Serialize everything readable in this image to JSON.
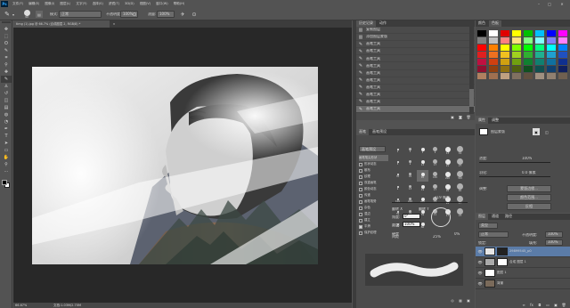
{
  "app": {
    "logo": "Ps"
  },
  "menubar": {
    "items": [
      "文件(F)",
      "编辑(E)",
      "图像(I)",
      "图层(L)",
      "文字(Y)",
      "选择(S)",
      "滤镜(T)",
      "3D(D)",
      "视图(V)",
      "窗口(W)",
      "帮助(H)"
    ]
  },
  "options": {
    "brush_size": "90",
    "mode_label": "模式:",
    "mode_value": "正常",
    "opacity_label": "不透明度:",
    "opacity_value": "100%",
    "flow_label": "流量:",
    "flow_value": "100%"
  },
  "document": {
    "tab_title": "timg (1).jpg @ 66.7% (合成图层 2, RGB/8) *"
  },
  "status": {
    "zoom": "66.67%",
    "doc_info": "文档:1.03M/2.70M"
  },
  "history": {
    "tabs": [
      "历史记录",
      "动作"
    ],
    "items": [
      "复制图层",
      "添加图层蒙版",
      "画笔工具",
      "画笔工具",
      "画笔工具",
      "画笔工具",
      "画笔工具",
      "画笔工具",
      "画笔工具",
      "画笔工具",
      "画笔工具",
      "画笔工具"
    ]
  },
  "swatches": {
    "tabs": [
      "颜色",
      "色板"
    ],
    "colors": [
      "#000000",
      "#ffffff",
      "#e00000",
      "#ffff00",
      "#00c000",
      "#00c0ff",
      "#0000ff",
      "#ff00ff",
      "#808080",
      "#c0c0c0",
      "#ff8080",
      "#ffe080",
      "#80ff80",
      "#80ffff",
      "#8080ff",
      "#ff80ff",
      "#ff0000",
      "#ff8000",
      "#ffff00",
      "#80ff00",
      "#00ff00",
      "#00ff80",
      "#00ffff",
      "#0080ff",
      "#e02020",
      "#f07020",
      "#f0c020",
      "#a0d020",
      "#30b030",
      "#20b090",
      "#20a0d0",
      "#2050c0",
      "#c01040",
      "#d04010",
      "#d0a010",
      "#70a010",
      "#108030",
      "#108070",
      "#1070a0",
      "#103090",
      "#901030",
      "#904010",
      "#907010",
      "#506010",
      "#105020",
      "#105050",
      "#104070",
      "#102060",
      "#b08060",
      "#a07050",
      "#c0a080",
      "#807060",
      "#605040",
      "#a09080",
      "#908070",
      "#706050"
    ]
  },
  "brush": {
    "tabs": [
      "画笔",
      "画笔预设"
    ],
    "preset_button": "画笔预设",
    "options": [
      "画笔笔尖形状",
      "形状动态",
      "散布",
      "纹理",
      "双重画笔",
      "颜色动态",
      "传递",
      "画笔笔势",
      "杂色",
      "湿边",
      "建立",
      "平滑",
      "保护纹理"
    ],
    "checked": [
      false,
      false,
      false,
      false,
      false,
      false,
      false,
      false,
      false,
      false,
      false,
      true,
      false
    ],
    "size_value": "119 像素",
    "flip_x": "翻转 X",
    "flip_y": "翻转 Y",
    "angle_label": "角度:",
    "angle_value": "0°",
    "roundness_label": "圆度:",
    "roundness_value": "100%",
    "hardness_label": "硬度",
    "hardness_value": "0%",
    "spacing_label": "间距",
    "spacing_value": "25%",
    "tip_sizes": [
      "1",
      "3",
      "5",
      "9",
      "13",
      "19",
      "5",
      "9",
      "13",
      "17",
      "21",
      "27",
      "35",
      "45",
      "65",
      "100",
      "200",
      "300",
      "9",
      "13",
      "19",
      "17",
      "45",
      "65",
      "100",
      "200",
      "300",
      "14",
      "24",
      "27",
      "39",
      "46",
      "59",
      "11",
      "17",
      "23",
      "36",
      "44",
      "60"
    ]
  },
  "properties": {
    "tabs": [
      "属性",
      "调整"
    ],
    "title": "图层蒙版",
    "density_label": "浓度:",
    "density_value": "100%",
    "feather_label": "羽化:",
    "feather_value": "0.0 像素",
    "refine_label": "调整:",
    "edge_button": "蒙版边缘...",
    "color_range_button": "颜色范围...",
    "invert_button": "反相"
  },
  "layers": {
    "tabs": [
      "图层",
      "通道",
      "路径"
    ],
    "filter_label": "类型",
    "blend_mode": "正常",
    "opacity_label": "不透明度:",
    "opacity_value": "100%",
    "lock_label": "锁定:",
    "fill_label": "填充:",
    "fill_value": "100%",
    "items": [
      {
        "name": "29899545_p0",
        "selected": true
      },
      {
        "name": "合成 图层 1",
        "selected": false
      },
      {
        "name": "图层 1",
        "selected": false
      },
      {
        "name": "背景",
        "selected": false
      }
    ]
  },
  "accent": {
    "selection": "#5b7ca8",
    "ps_blue": "#31a8ff"
  }
}
